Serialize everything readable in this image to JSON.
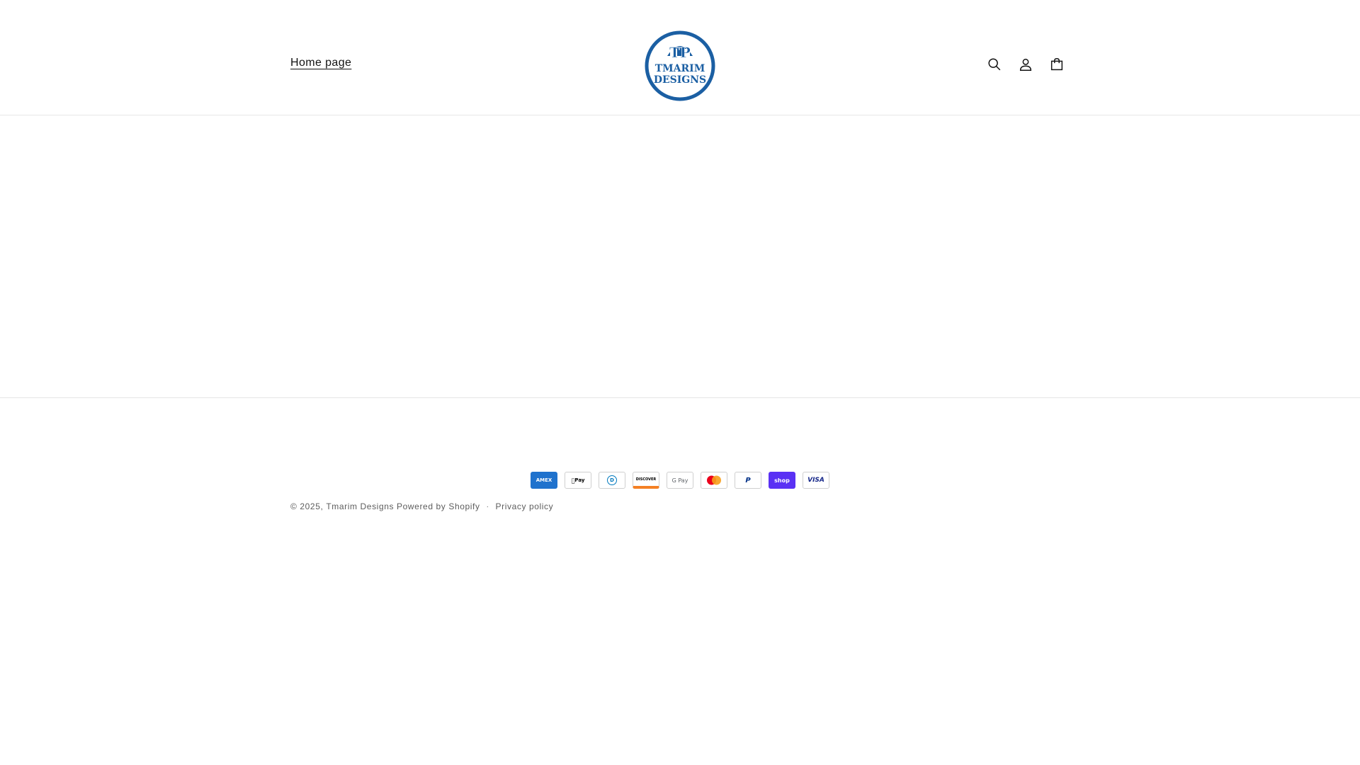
{
  "header": {
    "nav_home_label": "Home page",
    "logo_top": "TP",
    "logo_line1": "TMARIM",
    "logo_line2": "DESIGNS",
    "icons": [
      "search-icon",
      "account-icon",
      "cart-icon"
    ],
    "brand_color": "#1b5fa3"
  },
  "footer": {
    "payment_methods": [
      {
        "name": "American Express",
        "icon": "amex-icon",
        "label": "AMEX"
      },
      {
        "name": "Apple Pay",
        "icon": "apple-pay-icon",
        "label": "Pay"
      },
      {
        "name": "Diners Club",
        "icon": "diners-club-icon",
        "label": "D"
      },
      {
        "name": "Discover",
        "icon": "discover-icon",
        "label": "DISCOVER"
      },
      {
        "name": "Google Pay",
        "icon": "google-pay-icon",
        "label": "G Pay"
      },
      {
        "name": "Mastercard",
        "icon": "mastercard-icon",
        "label": ""
      },
      {
        "name": "PayPal",
        "icon": "paypal-icon",
        "label": "P"
      },
      {
        "name": "Shop Pay",
        "icon": "shop-pay-icon",
        "label": "shop"
      },
      {
        "name": "Visa",
        "icon": "visa-icon",
        "label": "VISA"
      }
    ],
    "copyright_prefix": "© 2025,",
    "store_name": "Tmarim Designs",
    "powered_by": "Powered by Shopify",
    "separator": "·",
    "privacy_policy": "Privacy policy"
  }
}
